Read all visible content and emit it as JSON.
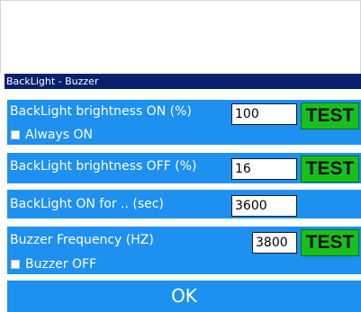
{
  "window": {
    "title": "BackLight - Buzzer"
  },
  "brightness_on": {
    "label": "BackLight brightness ON  (%)",
    "value": "100",
    "test_label": "TEST"
  },
  "always_on": {
    "label": "Always ON",
    "checked": false
  },
  "brightness_off": {
    "label": "BackLight brightness OFF (%)",
    "value": "16",
    "test_label": "TEST"
  },
  "on_for": {
    "label": "BackLight ON for .. (sec)",
    "value": "3600"
  },
  "buzzer": {
    "label": "Buzzer Frequency (HZ)",
    "value": "3800",
    "test_label": "TEST"
  },
  "buzzer_off": {
    "label": "Buzzer OFF",
    "checked": false
  },
  "ok_button": {
    "label": "OK"
  },
  "colors": {
    "title_bar": "#08206e",
    "panel": "#1e90f0",
    "test_button": "#19c01c"
  }
}
